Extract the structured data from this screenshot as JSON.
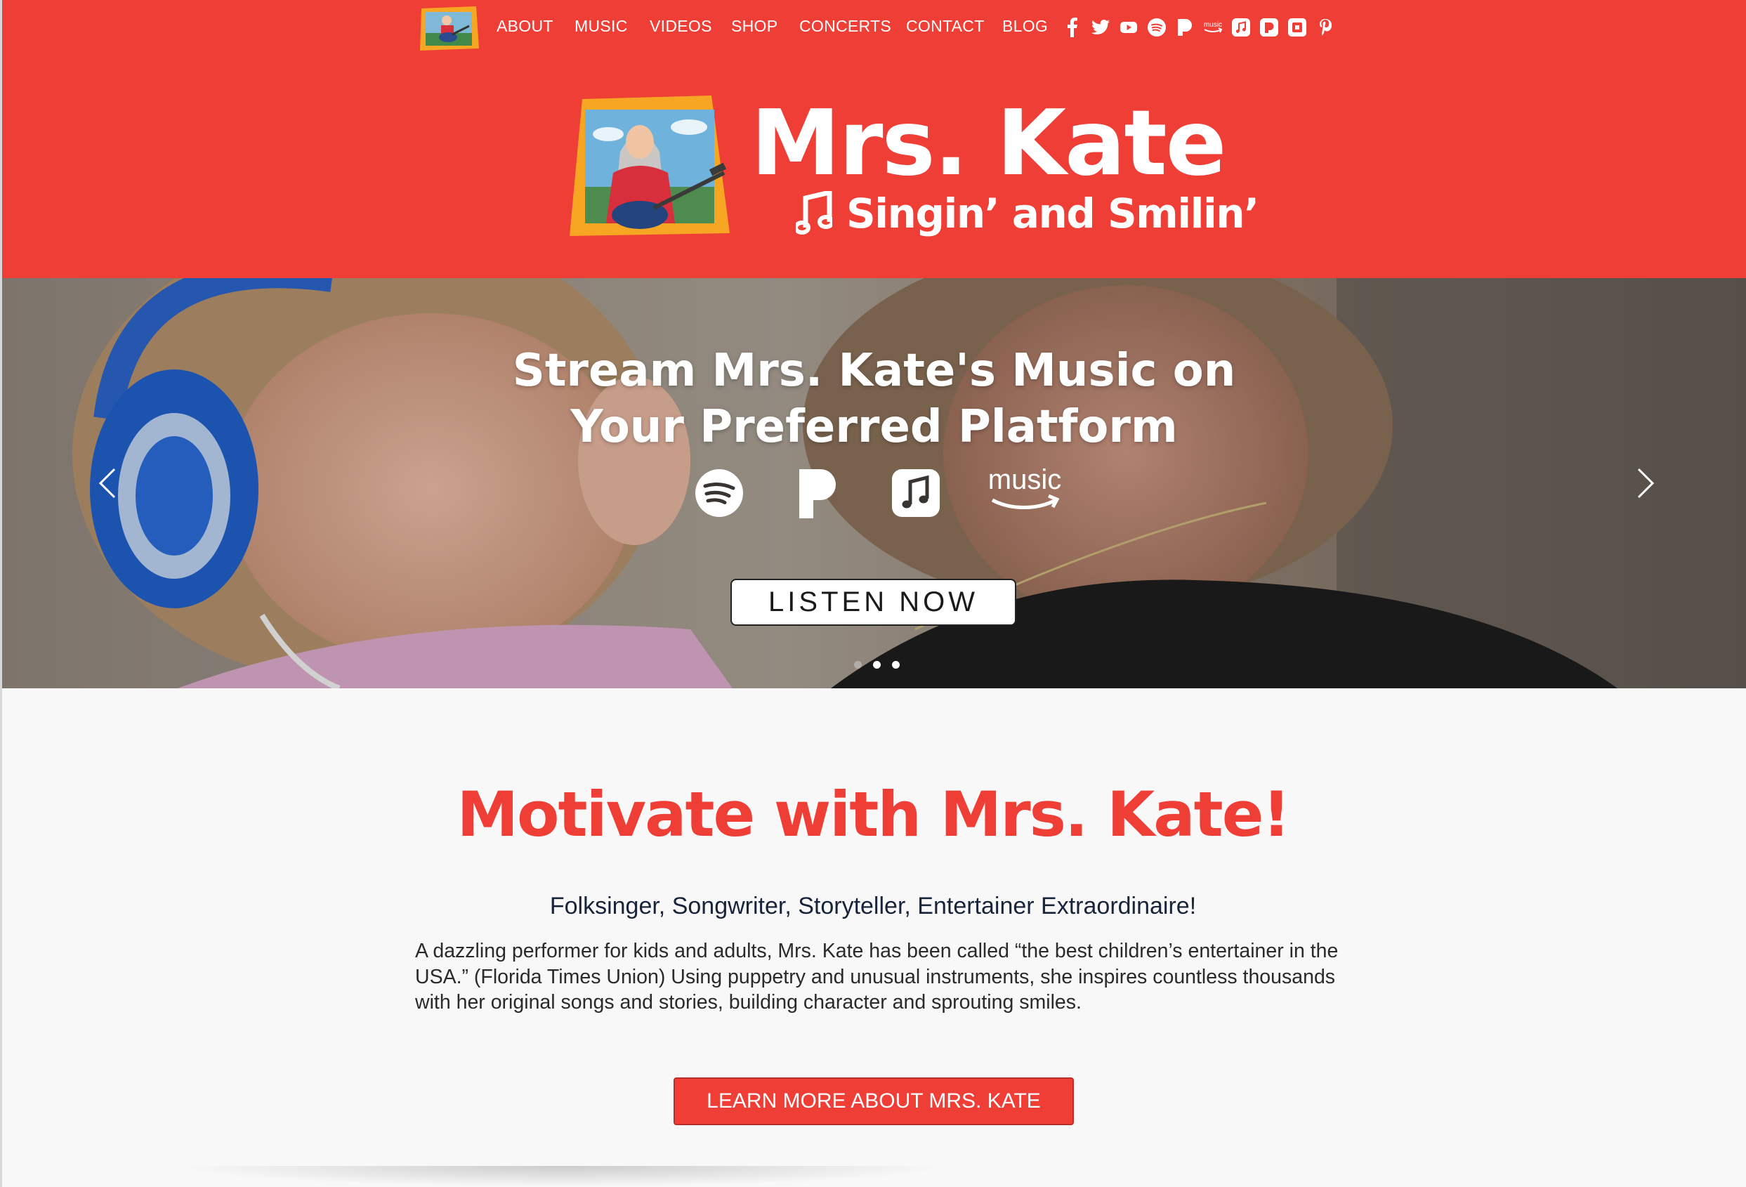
{
  "nav": {
    "links": [
      "ABOUT",
      "MUSIC",
      "VIDEOS",
      "SHOP",
      "CONCERTS",
      "CONTACT",
      "BLOG"
    ],
    "social_icons": [
      "facebook-icon",
      "twitter-icon",
      "youtube-icon",
      "spotify-icon",
      "pandora-icon",
      "amazon-music-icon",
      "apple-music-icon",
      "pandora-alt-icon",
      "square-icon",
      "pinterest-icon"
    ],
    "amazon_small_text": "music"
  },
  "brand": {
    "title": "Mrs. Kate",
    "tagline": "Singin’ and Smilin’"
  },
  "hero": {
    "title_line1": "Stream Mrs. Kate's Music on",
    "title_line2": "Your Preferred Platform",
    "platforms": [
      "spotify-icon",
      "pandora-icon",
      "apple-music-icon",
      "amazon-music-icon"
    ],
    "amazon_text": "music",
    "listen_label": "LISTEN NOW",
    "slide_count": 3,
    "active_slide": 1
  },
  "main": {
    "headline": "Motivate with Mrs. Kate!",
    "subhead": "Folksinger, Songwriter, Storyteller, Entertainer Extraordinaire!",
    "body": "A dazzling performer for kids and adults, Mrs. Kate has been called “the best children’s entertainer in the USA.” (Florida Times Union) Using puppetry and unusual instruments, she inspires countless thousands with her original songs and stories, building character and sprouting smiles.",
    "learn_more_label": "LEARN MORE ABOUT MRS. KATE"
  },
  "colors": {
    "brand_red": "#ee3e36",
    "frame_orange": "#f6a623",
    "text_dark": "#18243a"
  }
}
